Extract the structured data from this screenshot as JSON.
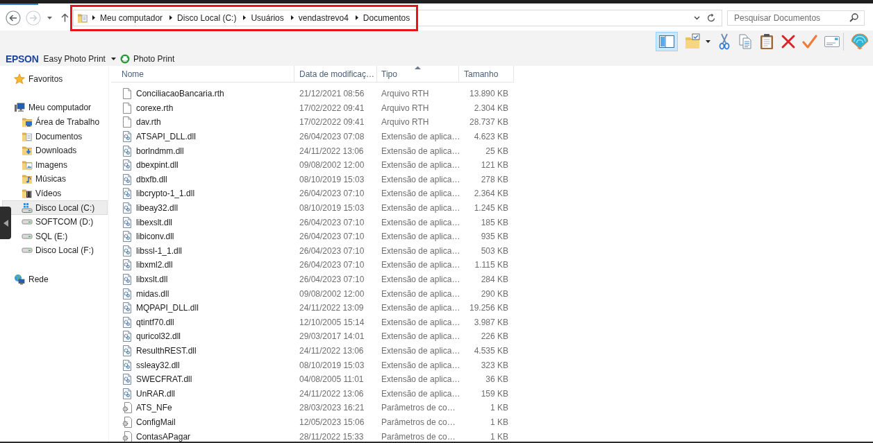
{
  "navigation": {
    "back": {
      "disabled": false
    },
    "forward": {
      "disabled": true
    }
  },
  "address_bar": {
    "highlighted": true,
    "breadcrumbs": [
      "Meu computador",
      "Disco Local (C:)",
      "Usuários",
      "vendastrevo4",
      "Documentos"
    ]
  },
  "search": {
    "placeholder": "Pesquisar Documentos"
  },
  "toolbar": {
    "layout_button": {
      "on": true
    }
  },
  "epson_bar": {
    "brand": "EPSON",
    "menu": "Easy Photo Print",
    "button": "Photo Print"
  },
  "sidebar": {
    "items": [
      {
        "label": "Favoritos",
        "kind": "favorites",
        "selected": false
      },
      {
        "label": "Meu computador",
        "kind": "computer",
        "selected": false,
        "children": [
          {
            "label": "Área de Trabalho",
            "kind": "desktop",
            "selected": false
          },
          {
            "label": "Documentos",
            "kind": "documents",
            "selected": false
          },
          {
            "label": "Downloads",
            "kind": "downloads",
            "selected": false
          },
          {
            "label": "Imagens",
            "kind": "pictures",
            "selected": false
          },
          {
            "label": "Músicas",
            "kind": "music",
            "selected": false
          },
          {
            "label": "Vídeos",
            "kind": "videos",
            "selected": false
          },
          {
            "label": "Disco Local (C:)",
            "kind": "systemdrive",
            "selected": true
          },
          {
            "label": "SOFTCOM (D:)",
            "kind": "drive",
            "selected": false
          },
          {
            "label": "SQL (E:)",
            "kind": "drive",
            "selected": false
          },
          {
            "label": "Disco Local (F:)",
            "kind": "drive",
            "selected": false
          }
        ]
      },
      {
        "label": "Rede",
        "kind": "network",
        "selected": false
      }
    ]
  },
  "file_list": {
    "columns": [
      {
        "label": "Nome",
        "sorted": false
      },
      {
        "label": "Data de modificaç…",
        "sorted": false
      },
      {
        "label": "Tipo",
        "sorted": true
      },
      {
        "label": "Tamanho",
        "sorted": false
      }
    ],
    "rows": [
      {
        "name": "ConciliacaoBancaria.rth",
        "modified": "21/12/2021 08:56",
        "type": "Arquivo RTH",
        "size": "13.890 KB",
        "kind": "text"
      },
      {
        "name": "corexe.rth",
        "modified": "17/02/2022 09:41",
        "type": "Arquivo RTH",
        "size": "2.304 KB",
        "kind": "text"
      },
      {
        "name": "dav.rth",
        "modified": "17/02/2022 09:41",
        "type": "Arquivo RTH",
        "size": "28.737 KB",
        "kind": "text"
      },
      {
        "name": "ATSAPI_DLL.dll",
        "modified": "26/04/2023 07:08",
        "type": "Extensão de aplica…",
        "size": "4.623 KB",
        "kind": "dll"
      },
      {
        "name": "borlndmm.dll",
        "modified": "24/11/2022 13:06",
        "type": "Extensão de aplica…",
        "size": "25 KB",
        "kind": "dll"
      },
      {
        "name": "dbexpint.dll",
        "modified": "09/08/2002 12:00",
        "type": "Extensão de aplica…",
        "size": "121 KB",
        "kind": "dll"
      },
      {
        "name": "dbxfb.dll",
        "modified": "08/10/2019 15:03",
        "type": "Extensão de aplica…",
        "size": "278 KB",
        "kind": "dll"
      },
      {
        "name": "libcrypto-1_1.dll",
        "modified": "26/04/2023 07:10",
        "type": "Extensão de aplica…",
        "size": "2.364 KB",
        "kind": "dll"
      },
      {
        "name": "libeay32.dll",
        "modified": "08/10/2019 15:03",
        "type": "Extensão de aplica…",
        "size": "1.245 KB",
        "kind": "dll"
      },
      {
        "name": "libexslt.dll",
        "modified": "26/04/2023 07:10",
        "type": "Extensão de aplica…",
        "size": "185 KB",
        "kind": "dll"
      },
      {
        "name": "libiconv.dll",
        "modified": "26/04/2023 07:10",
        "type": "Extensão de aplica…",
        "size": "935 KB",
        "kind": "dll"
      },
      {
        "name": "libssl-1_1.dll",
        "modified": "26/04/2023 07:10",
        "type": "Extensão de aplica…",
        "size": "503 KB",
        "kind": "dll"
      },
      {
        "name": "libxml2.dll",
        "modified": "26/04/2023 07:10",
        "type": "Extensão de aplica…",
        "size": "1.115 KB",
        "kind": "dll"
      },
      {
        "name": "libxslt.dll",
        "modified": "26/04/2023 07:10",
        "type": "Extensão de aplica…",
        "size": "284 KB",
        "kind": "dll"
      },
      {
        "name": "midas.dll",
        "modified": "09/08/2002 12:00",
        "type": "Extensão de aplica…",
        "size": "290 KB",
        "kind": "dll"
      },
      {
        "name": "MQPAPI_DLL.dll",
        "modified": "24/11/2022 13:09",
        "type": "Extensão de aplica…",
        "size": "19.256 KB",
        "kind": "dll"
      },
      {
        "name": "qtintf70.dll",
        "modified": "12/10/2005 15:14",
        "type": "Extensão de aplica…",
        "size": "3.987 KB",
        "kind": "dll"
      },
      {
        "name": "quricol32.dll",
        "modified": "29/03/2017 14:01",
        "type": "Extensão de aplica…",
        "size": "226 KB",
        "kind": "dll"
      },
      {
        "name": "ResulthREST.dll",
        "modified": "24/11/2022 13:06",
        "type": "Extensão de aplica…",
        "size": "4.535 KB",
        "kind": "dll"
      },
      {
        "name": "ssleay32.dll",
        "modified": "08/10/2019 15:03",
        "type": "Extensão de aplica…",
        "size": "323 KB",
        "kind": "dll"
      },
      {
        "name": "SWECFRAT.dll",
        "modified": "04/08/2005 11:01",
        "type": "Extensão de aplica…",
        "size": "36 KB",
        "kind": "dll"
      },
      {
        "name": "UnRAR.dll",
        "modified": "24/11/2022 13:06",
        "type": "Extensão de aplica…",
        "size": "159 KB",
        "kind": "dll"
      },
      {
        "name": "ATS_NFe",
        "modified": "28/03/2023 16:21",
        "type": "Parâmetros de co…",
        "size": "1 KB",
        "kind": "config"
      },
      {
        "name": "ConfigMail",
        "modified": "12/05/2023 15:06",
        "type": "Parâmetros de co…",
        "size": "1 KB",
        "kind": "config"
      },
      {
        "name": "ContasAPagar",
        "modified": "28/11/2022 15:33",
        "type": "Parâmetros de co…",
        "size": "1 KB",
        "kind": "config"
      }
    ]
  }
}
